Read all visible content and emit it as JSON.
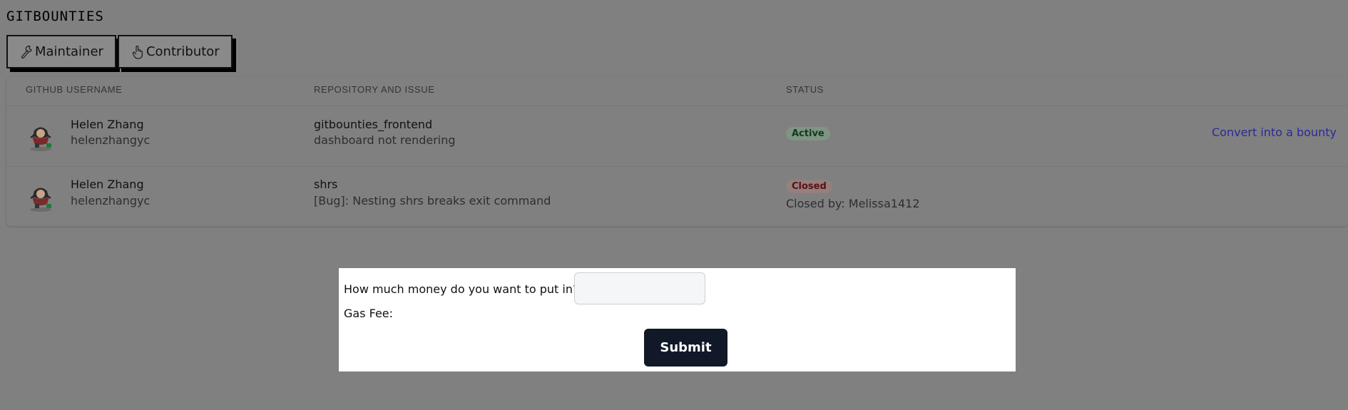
{
  "app": {
    "brand": "GITBOUNTIES"
  },
  "tabs": [
    {
      "label": "Maintainer",
      "icon": "wrench-icon"
    },
    {
      "label": "Contributor",
      "icon": "hand-pointer-icon"
    }
  ],
  "table": {
    "headers": [
      "GITHUB USERNAME",
      "REPOSITORY AND ISSUE",
      "STATUS"
    ],
    "rows": [
      {
        "name": "Helen Zhang",
        "handle": "helenzhangyc",
        "repo": "gitbounties_frontend",
        "issue": "dashboard not rendering",
        "status": "Active",
        "status_color": "#0f3d1b",
        "action": "Convert into a bounty"
      },
      {
        "name": "Helen Zhang",
        "handle": "helenzhangyc",
        "repo": "shrs",
        "issue": "[Bug]: Nesting shrs breaks exit command",
        "status": "Closed",
        "status_color": "#5a1010",
        "closed_by": "Closed by: Melissa1412"
      }
    ]
  },
  "modal": {
    "question": "How much money do you want to put in?",
    "amount_value": "",
    "gas_fee_label": "Gas Fee:",
    "submit_label": "Submit"
  },
  "colors": {
    "overlay": "#808080",
    "submit_bg": "#111827",
    "link": "#2a2a9a"
  }
}
